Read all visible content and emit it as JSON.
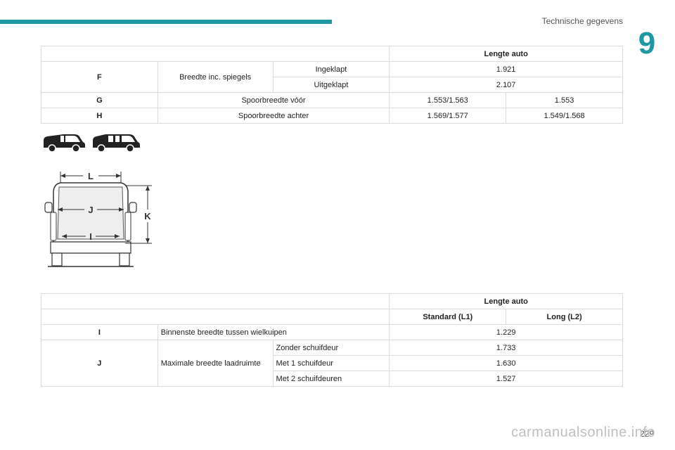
{
  "header": {
    "title": "Technische gegevens",
    "chapter": "9",
    "accent": "#1e98a2"
  },
  "table1": {
    "heading": "Lengte auto",
    "rows": [
      {
        "code": "F",
        "label": "Breedte inc. spiegels",
        "sub1": "Ingeklapt",
        "value1": "1.921",
        "sub2": "Uitgeklapt",
        "value2": "2.107"
      },
      {
        "code": "G",
        "label": "Spoorbreedte vóór",
        "a": "1.553/1.563",
        "b": "1.553"
      },
      {
        "code": "H",
        "label": "Spoorbreedte achter",
        "a": "1.569/1.577",
        "b": "1.549/1.568"
      }
    ]
  },
  "diagram": {
    "labels": {
      "L": "L",
      "J": "J",
      "I": "I",
      "K": "K"
    }
  },
  "table2": {
    "heading": "Lengte auto",
    "col1": "Standard (L1)",
    "col2": "Long (L2)",
    "rowI": {
      "code": "I",
      "label": "Binnenste breedte tussen wielkuipen",
      "value": "1.229"
    },
    "rowJ": {
      "code": "J",
      "label": "Maximale breedte laadruimte",
      "subs": [
        {
          "label": "Zonder schuifdeur",
          "value": "1.733"
        },
        {
          "label": "Met 1 schuifdeur",
          "value": "1.630"
        },
        {
          "label": "Met 2 schuifdeuren",
          "value": "1.527"
        }
      ]
    }
  },
  "footer": {
    "page": "229",
    "watermark": "carmanualsonline.info"
  }
}
